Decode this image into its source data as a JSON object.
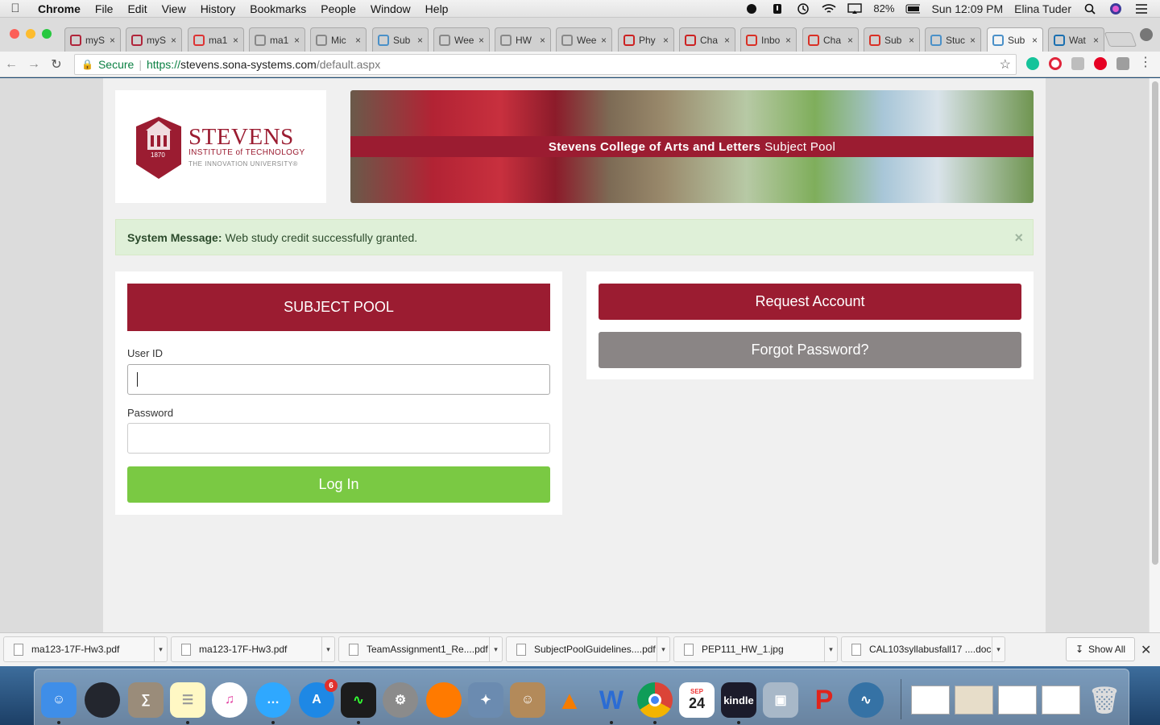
{
  "menubar": {
    "app": "Chrome",
    "items": [
      "File",
      "Edit",
      "View",
      "History",
      "Bookmarks",
      "People",
      "Window",
      "Help"
    ],
    "battery": "82%",
    "clock": "Sun 12:09 PM",
    "user": "Elina Tuder"
  },
  "tabs": [
    {
      "title": "myS",
      "favicon": "ma-icon",
      "color": "#b0243a"
    },
    {
      "title": "myS",
      "favicon": "ma-icon",
      "color": "#b0243a"
    },
    {
      "title": "ma1",
      "favicon": "loading-icon",
      "color": "#d33"
    },
    {
      "title": "ma1",
      "favicon": "document-icon",
      "color": "#888"
    },
    {
      "title": "Mic",
      "favicon": "document-icon",
      "color": "#888"
    },
    {
      "title": "Sub",
      "favicon": "sona-icon",
      "color": "#4a90c8"
    },
    {
      "title": "Wee",
      "favicon": "document-icon",
      "color": "#888"
    },
    {
      "title": "HW",
      "favicon": "document-icon",
      "color": "#888"
    },
    {
      "title": "Wee",
      "favicon": "document-icon",
      "color": "#888"
    },
    {
      "title": "Phy",
      "favicon": "wolfram-icon",
      "color": "#c22"
    },
    {
      "title": "Cha",
      "favicon": "wolfram-icon",
      "color": "#c22"
    },
    {
      "title": "Inbo",
      "favicon": "gmail-icon",
      "color": "#d93025"
    },
    {
      "title": "Cha",
      "favicon": "gmail-icon",
      "color": "#d93025"
    },
    {
      "title": "Sub",
      "favicon": "gmail-icon",
      "color": "#d93025"
    },
    {
      "title": "Stuc",
      "favicon": "sona-icon",
      "color": "#4a90c8"
    },
    {
      "title": "Sub",
      "favicon": "sona-icon",
      "color": "#4a90c8",
      "active": true
    },
    {
      "title": "Wat",
      "favicon": "store-icon",
      "color": "#1a6fb0"
    }
  ],
  "address_bar": {
    "secure_label": "Secure",
    "scheme": "https://",
    "host": "stevens.sona-systems.com",
    "path": "/default.aspx"
  },
  "logo": {
    "name": "STEVENS",
    "line1": "INSTITUTE of TECHNOLOGY",
    "line2": "THE INNOVATION UNIVERSITY®",
    "year": "1870"
  },
  "banner": {
    "bold": "Stevens College of Arts and Letters",
    "rest": "Subject Pool"
  },
  "system_message": {
    "label": "System Message:",
    "text": "Web study credit successfully granted.",
    "close": "×"
  },
  "login": {
    "header": "SUBJECT POOL",
    "user_id_label": "User ID",
    "user_id_value": "",
    "password_label": "Password",
    "password_value": "",
    "submit": "Log In"
  },
  "side": {
    "request": "Request Account",
    "forgot": "Forgot Password?"
  },
  "downloads": [
    "ma123-17F-Hw3.pdf",
    "ma123-17F-Hw3.pdf",
    "TeamAssignment1_Re....pdf",
    "SubjectPoolGuidelines....pdf",
    "PEP111_HW_1.jpg",
    "CAL103syllabusfall17 ....doc"
  ],
  "show_all": "Show All",
  "dock": {
    "calendar_month": "SEP",
    "calendar_day": "24",
    "appstore_badge": "6",
    "kindle": "kindle"
  },
  "colors": {
    "brand": "#9b1c31",
    "login_green": "#7ac943",
    "forgot_gray": "#8a8585",
    "success_bg": "#dff0d8"
  }
}
